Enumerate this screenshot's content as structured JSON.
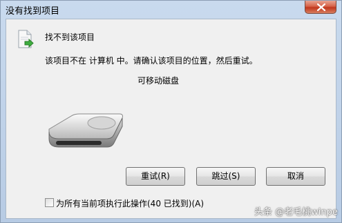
{
  "window": {
    "title": "没有找到项目"
  },
  "dialog": {
    "heading": "找不到该项目",
    "message": "该项目不在 计算机 中。请确认该项目的位置，然后重试。",
    "location": "可移动磁盘"
  },
  "buttons": {
    "retry": "重试(R)",
    "skip": "跳过(S)",
    "cancel": "取消"
  },
  "options": {
    "apply_all_label": "为所有当前项执行此操作(40 已找到)(A)",
    "apply_all_checked": false
  },
  "watermark": {
    "text": "头条 @老毛桃winpe"
  },
  "icons": {
    "title_close": "close-icon",
    "file": "file-arrow-icon",
    "drive": "removable-drive-icon"
  },
  "colors": {
    "close_button": "#c1371d",
    "title_bar": "#c9daee",
    "client_bg": "#f0f0f0"
  }
}
